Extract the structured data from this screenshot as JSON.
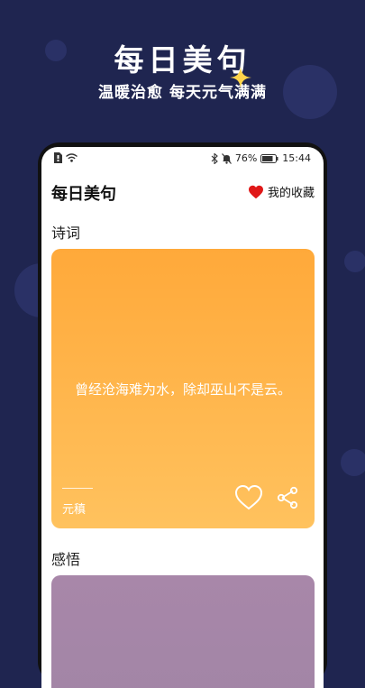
{
  "promo": {
    "title": "每日美句",
    "subtitle": "温暖治愈 每天元气满满"
  },
  "status_bar": {
    "battery": "76%",
    "time": "15:44"
  },
  "header": {
    "app_title": "每日美句",
    "favorites_label": "我的收藏"
  },
  "sections": [
    {
      "title": "诗词",
      "quote": "曾经沧海难为水，除却巫山不是云。",
      "author": "元稹"
    },
    {
      "title": "感悟"
    }
  ],
  "colors": {
    "background": "#1f2550",
    "poetry_card": "#ffb047",
    "insight_card": "#a887a9",
    "heart": "#e01818"
  }
}
